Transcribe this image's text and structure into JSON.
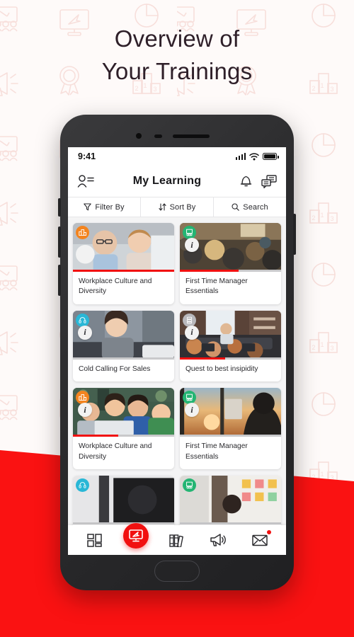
{
  "headline": {
    "line1": "Overview of",
    "line2": "Your Trainings"
  },
  "colors": {
    "brand_red": "#fa1212",
    "headline": "#2e1f29",
    "pattern": "#f6cfcb",
    "progress_track": "#c9c9cb"
  },
  "background": {
    "pattern_icons": [
      "presentation-icon",
      "monitor-cursor-icon",
      "megaphone-icon",
      "award-ribbon-icon",
      "pie-chart-icon",
      "podium-icon"
    ]
  },
  "phone": {
    "status_bar": {
      "time": "9:41",
      "signal": "signal-bars-icon",
      "wifi": "wifi-icon",
      "battery": "battery-full-icon"
    },
    "header": {
      "title": "My Learning",
      "left_icon": "profile-list-icon",
      "right_icons": [
        "bell-icon",
        "chat-icon"
      ]
    },
    "toolbar": [
      {
        "label": "Filter By",
        "icon": "filter-icon"
      },
      {
        "label": "Sort By",
        "icon": "sort-icon"
      },
      {
        "label": "Search",
        "icon": "search-icon"
      }
    ],
    "cards": [
      {
        "title": "Workplace Culture and Diversity",
        "badge_color": "#f3841f",
        "badge_icon": "podium-icon",
        "has_info": false,
        "progress": 100,
        "photo": "team-smiling-office"
      },
      {
        "title": "First Time Manager Essentials",
        "badge_color": "#24b573",
        "badge_icon": "presentation-icon",
        "has_info": true,
        "progress": 58,
        "photo": "conference-audience"
      },
      {
        "title": "Cold Calling For Sales",
        "badge_color": "#29b7d6",
        "badge_icon": "headset-icon",
        "has_info": true,
        "progress": 0,
        "photo": "woman-headset-desk"
      },
      {
        "title": "Quest to best insipidity",
        "badge_color": "#b8b8bc",
        "badge_icon": "list-icon",
        "has_info": true,
        "progress": 45,
        "photo": "office-meeting-room"
      },
      {
        "title": "Workplace Culture and Diversity",
        "badge_color": "#f3841f",
        "badge_icon": "podium-icon",
        "has_info": true,
        "progress": 45,
        "photo": "colleagues-at-laptop"
      },
      {
        "title": "First Time Manager Essentials",
        "badge_color": "#24b573",
        "badge_icon": "presentation-icon",
        "has_info": true,
        "progress": 0,
        "photo": "sunset-window-silhouette"
      },
      {
        "title": "",
        "badge_color": "#29b7d6",
        "badge_icon": "headset-icon",
        "has_info": false,
        "progress": 0,
        "photo": "dark-studio"
      },
      {
        "title": "",
        "badge_color": "#24b573",
        "badge_icon": "presentation-icon",
        "has_info": false,
        "progress": 0,
        "photo": "sticky-notes-wall"
      }
    ],
    "bottom_nav": [
      {
        "icon": "dashboard-grid-icon",
        "active": false,
        "dot": false
      },
      {
        "icon": "monitor-learning-icon",
        "active": true,
        "dot": false
      },
      {
        "icon": "books-icon",
        "active": false,
        "dot": false
      },
      {
        "icon": "megaphone-icon",
        "active": false,
        "dot": false
      },
      {
        "icon": "envelope-icon",
        "active": false,
        "dot": true
      }
    ]
  }
}
